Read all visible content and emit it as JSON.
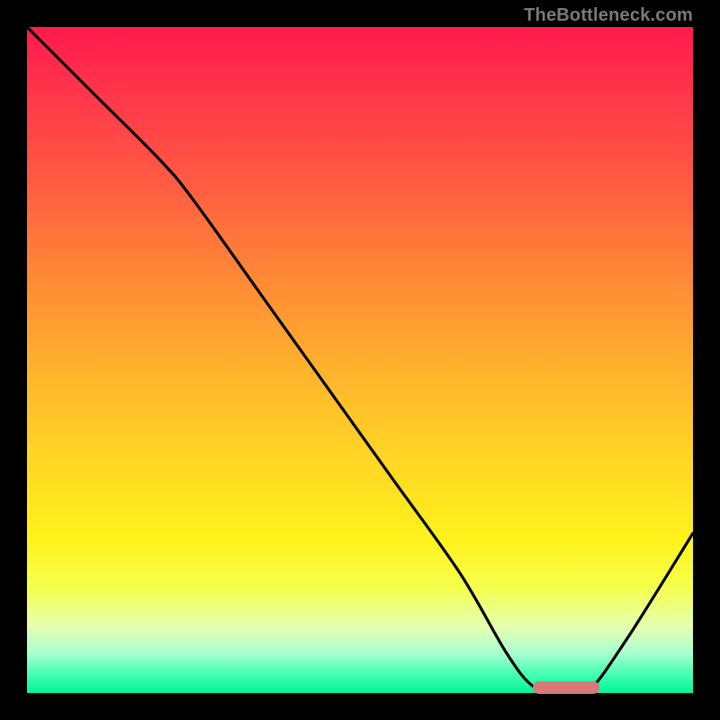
{
  "watermark": "TheBottleneck.com",
  "chart_data": {
    "type": "line",
    "title": "",
    "xlabel": "",
    "ylabel": "",
    "xlim": [
      0,
      100
    ],
    "ylim": [
      0,
      100
    ],
    "x": [
      0,
      10,
      20,
      25,
      35,
      45,
      55,
      65,
      72,
      76,
      80,
      84,
      90,
      100
    ],
    "values": [
      100,
      90,
      80,
      74,
      60,
      46,
      32,
      18,
      6,
      1,
      0,
      0,
      8,
      24
    ],
    "optimal_range_x": [
      76,
      86
    ],
    "optimal_y": 0.8,
    "colors": {
      "gradient_top": "#ff1a4d",
      "gradient_bottom": "#00f59a",
      "curve": "#000000",
      "marker": "#d87a7a",
      "frame": "#000000"
    }
  }
}
